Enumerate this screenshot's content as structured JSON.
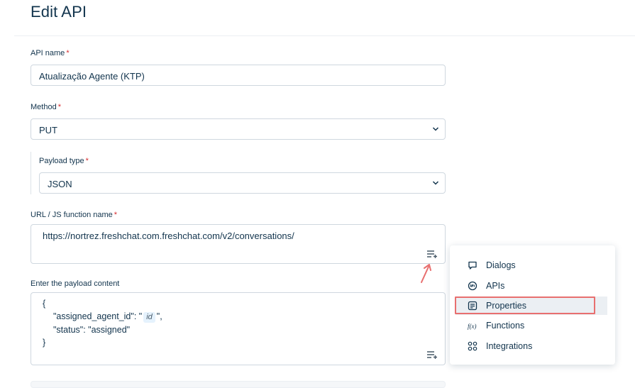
{
  "header": {
    "title": "Edit API"
  },
  "form": {
    "api_name": {
      "label": "API name",
      "required": "*",
      "value": "Atualização Agente (KTP)"
    },
    "method": {
      "label": "Method",
      "required": "*",
      "value": "PUT"
    },
    "payload_type": {
      "label": "Payload type",
      "required": "*",
      "value": "JSON"
    },
    "url": {
      "label": "URL / JS function name",
      "required": "*",
      "value": "https://nortrez.freshchat.com.freshchat.com/v2/conversations/"
    },
    "payload": {
      "label": "Enter the payload content",
      "line1": "{",
      "line2_key": "\"assigned_agent_id\": \"",
      "line2_chip": "id",
      "line2_end": "\",",
      "line3": "\"status\": \"assigned\"",
      "line4": "}"
    }
  },
  "insert_menu": {
    "items": [
      {
        "label": "Dialogs",
        "icon": "chat-bubble-icon"
      },
      {
        "label": "APIs",
        "icon": "api-icon"
      },
      {
        "label": "Properties",
        "icon": "properties-icon"
      },
      {
        "label": "Functions",
        "icon": "function-icon"
      },
      {
        "label": "Integrations",
        "icon": "integrations-icon"
      }
    ],
    "highlighted": "Properties"
  },
  "colors": {
    "text": "#12344d",
    "border": "#cfd7df",
    "required": "#d72d30",
    "highlight": "#e86f6f",
    "chip_bg": "#e5f2fd"
  }
}
